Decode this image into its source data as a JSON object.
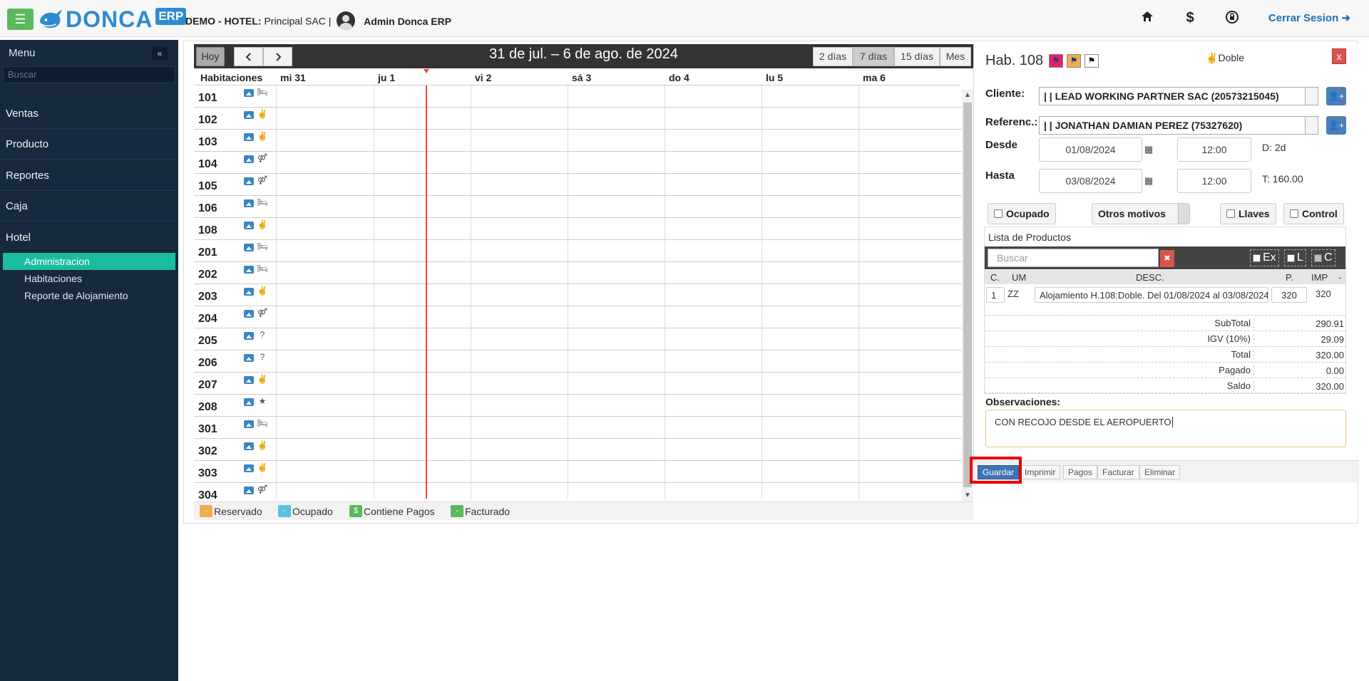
{
  "header": {
    "company_label": "DEMO - HOTEL:",
    "company_value": "Principal SAC |",
    "admin_name": "Admin Donca ERP",
    "logo_text": "DONCA",
    "logo_badge": "ERP",
    "logout_label": "Cerrar Sesion",
    "icons": [
      "home-icon",
      "dollar-icon",
      "lock-icon",
      "logout-icon"
    ]
  },
  "sidebar": {
    "title": "Menu",
    "search_placeholder": "Buscar",
    "items": [
      {
        "label": "Ventas"
      },
      {
        "label": "Producto"
      },
      {
        "label": "Reportes"
      },
      {
        "label": "Caja"
      },
      {
        "label": "Hotel"
      }
    ],
    "subitems": [
      {
        "label": "Administracion",
        "active": true
      },
      {
        "label": "Habitaciones",
        "active": false
      },
      {
        "label": "Reporte de Alojamiento",
        "active": false
      }
    ]
  },
  "calendar": {
    "today_label": "Hoy",
    "prev_label": "<",
    "next_label": ">",
    "title": "31 de jul. – 6 de ago. de 2024",
    "views": [
      "2 días",
      "7 días",
      "15 días",
      "Mes"
    ],
    "active_view": "7 días",
    "resource_header": "Habitaciones",
    "days": [
      "mi 31",
      "ju 1",
      "vi 2",
      "sá 3",
      "do 4",
      "lu 5",
      "ma 6"
    ],
    "rooms": [
      {
        "number": "101",
        "type_icon": "bed-icon"
      },
      {
        "number": "102",
        "type_icon": "peace-icon"
      },
      {
        "number": "103",
        "type_icon": "peace-icon"
      },
      {
        "number": "104",
        "type_icon": "couple-icon"
      },
      {
        "number": "105",
        "type_icon": "couple-icon"
      },
      {
        "number": "106",
        "type_icon": "bed-icon"
      },
      {
        "number": "108",
        "type_icon": "peace-icon"
      },
      {
        "number": "201",
        "type_icon": "bed-icon"
      },
      {
        "number": "202",
        "type_icon": "bed-icon"
      },
      {
        "number": "203",
        "type_icon": "peace-icon"
      },
      {
        "number": "204",
        "type_icon": "couple-icon"
      },
      {
        "number": "205",
        "type_icon": "question-icon"
      },
      {
        "number": "206",
        "type_icon": "question-icon"
      },
      {
        "number": "207",
        "type_icon": "peace-icon"
      },
      {
        "number": "208",
        "type_icon": "star-icon"
      },
      {
        "number": "301",
        "type_icon": "bed-icon"
      },
      {
        "number": "302",
        "type_icon": "peace-icon"
      },
      {
        "number": "303",
        "type_icon": "peace-icon"
      },
      {
        "number": "304",
        "type_icon": "couple-icon"
      }
    ],
    "legend": [
      {
        "symbol": "-",
        "label": "Reservado",
        "color": "#f0ad4e"
      },
      {
        "symbol": "-",
        "label": "Ocupado",
        "color": "#5bc0de"
      },
      {
        "symbol": "$",
        "label": "Contiene Pagos",
        "color": "#5cb85c"
      },
      {
        "symbol": "-",
        "label": "Facturado",
        "color": "#5cb85c"
      }
    ]
  },
  "form": {
    "hab_title": "Hab. 108",
    "tipo": "Doble",
    "close_label": "x",
    "cliente_label": "Cliente:",
    "cliente_value": "| | LEAD WORKING PARTNER SAC (20573215045)",
    "referenc_label": "Referenc.:",
    "referenc_value": "| | JONATHAN DAMIAN PEREZ (75327620)",
    "desde_label": "Desde",
    "desde_date": "01/08/2024",
    "desde_time": "12:00",
    "dias_info": "D: 2d",
    "hasta_label": "Hasta",
    "hasta_date": "03/08/2024",
    "hasta_time": "12:00",
    "total_info": "T: 160.00",
    "ocupado_label": "Ocupado",
    "motivos_label": "Otros motivos",
    "llaves_label": "Llaves",
    "control_label": "Control",
    "productos_title": "Lista de Productos",
    "productos_search_placeholder": "Buscar",
    "prod_checks": [
      "Ex",
      "L",
      "C"
    ],
    "prod_headers": {
      "c": "C.",
      "um": "UM",
      "desc": "DESC.",
      "p": "P.",
      "imp": "IMP",
      "del": "-"
    },
    "prod_row": {
      "c": "1",
      "um": "ZZ",
      "desc": "Alojamiento H.108:Doble. Del 01/08/2024 al 03/08/2024",
      "p": "320",
      "imp": "320"
    },
    "totals": [
      {
        "label": "SubTotal",
        "value": "290.91"
      },
      {
        "label": "IGV (10%)",
        "value": "29.09"
      },
      {
        "label": "Total",
        "value": "320.00"
      },
      {
        "label": "Pagado",
        "value": "0.00"
      },
      {
        "label": "Saldo",
        "value": "320.00"
      }
    ],
    "obs_label": "Observaciones:",
    "obs_value": "CON RECOJO DESDE EL AEROPUERTO",
    "actions": [
      "Guardar",
      "Imprimir",
      "Pagos",
      "Facturar",
      "Eliminar"
    ]
  }
}
